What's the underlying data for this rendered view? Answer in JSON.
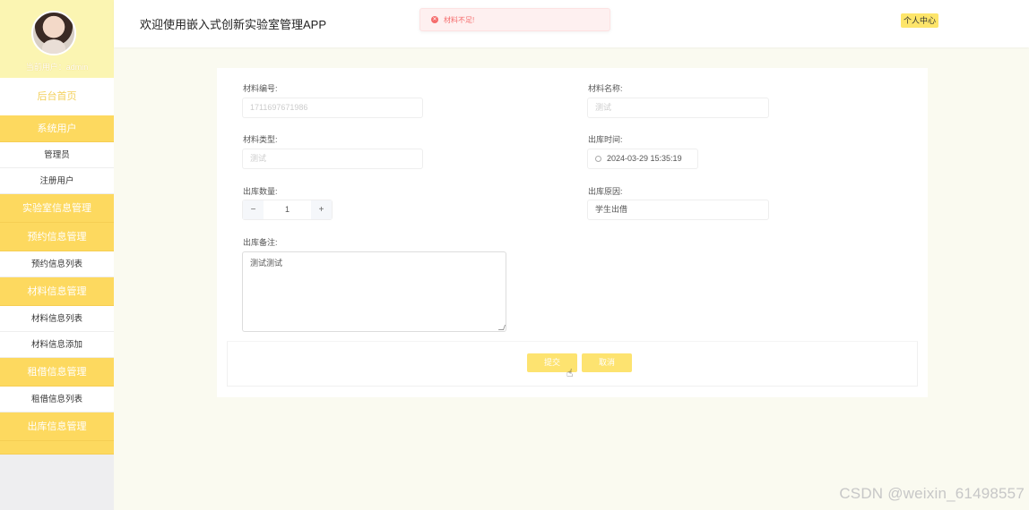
{
  "app": {
    "title": "欢迎使用嵌入式创新实验室管理APP",
    "user_center": "个人中心"
  },
  "toast": {
    "icon": "error-icon",
    "message": "材料不足!"
  },
  "profile": {
    "user_label": "当前用户：",
    "username": "admin"
  },
  "sidebar": {
    "home": "后台首页",
    "groups": [
      {
        "label": "系统用户",
        "items": [
          "管理员",
          "注册用户"
        ]
      },
      {
        "label": "实验室信息管理",
        "items": []
      },
      {
        "label": "预约信息管理",
        "items": [
          "预约信息列表"
        ]
      },
      {
        "label": "材料信息管理",
        "items": [
          "材料信息列表",
          "材料信息添加"
        ]
      },
      {
        "label": "租借信息管理",
        "items": [
          "租借信息列表"
        ]
      },
      {
        "label": "出库信息管理",
        "items": []
      }
    ]
  },
  "form": {
    "material_no": {
      "label": "材料编号:",
      "placeholder": "1711697671986"
    },
    "material_name": {
      "label": "材料名称:",
      "placeholder": "测试"
    },
    "material_type": {
      "label": "材料类型:",
      "placeholder": "测试"
    },
    "out_time": {
      "label": "出库时间:",
      "value": "2024-03-29 15:35:19"
    },
    "out_qty": {
      "label": "出库数量:",
      "value": "1",
      "minus": "−",
      "plus": "+"
    },
    "out_reason": {
      "label": "出库原因:",
      "value": "学生出借"
    },
    "out_note": {
      "label": "出库备注:",
      "value": "测试测试"
    },
    "submit": "提交",
    "cancel": "取消"
  },
  "watermark": "CSDN @weixin_61498557",
  "colors": {
    "accent": "#fdd95f",
    "profile_bg": "#fbf5b2",
    "error": "#f56c6c"
  }
}
